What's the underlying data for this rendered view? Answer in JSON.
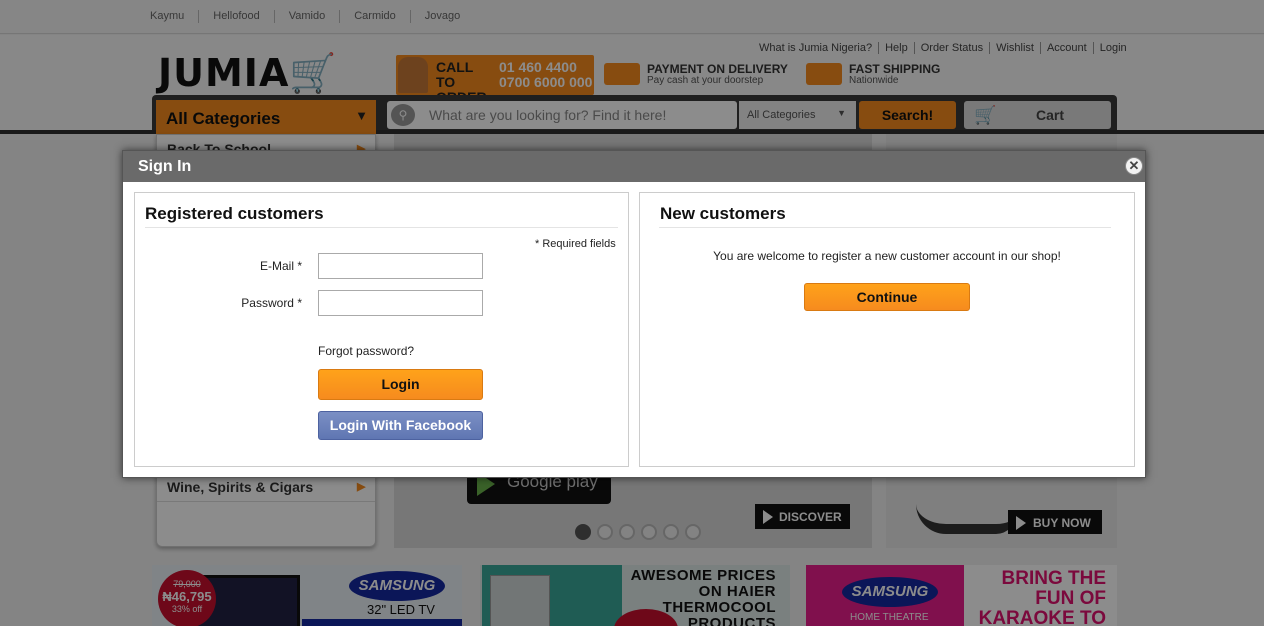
{
  "topbar": {
    "sites": [
      "Kaymu",
      "Hellofood",
      "Vamido",
      "Carmido",
      "Jovago"
    ]
  },
  "header": {
    "logo": "JUMIA",
    "links": [
      "What is Jumia Nigeria?",
      "Help",
      "Order Status",
      "Wishlist",
      "Account",
      "Login"
    ],
    "promo_call": {
      "title": "CALL TO ORDER",
      "numbers": "01 460 4400\n0700 6000 000"
    },
    "promo_pay": {
      "title": "PAYMENT ON DELIVERY",
      "sub": "Pay cash at your doorstep"
    },
    "promo_ship": {
      "title": "FAST SHIPPING",
      "sub": "Nationwide"
    }
  },
  "nav": {
    "all_categories": "All Categories",
    "search_placeholder": "What are you looking for? Find it here!",
    "search_category": "All Categories",
    "search_button": "Search!",
    "cart": "Cart"
  },
  "categories": {
    "first": "Back To School",
    "last": "Wine, Spirits & Cigars"
  },
  "slider": {
    "store_badge": "Google play",
    "discover": "DISCOVER",
    "dots": 6,
    "active_dot": 0
  },
  "side_ad": {
    "buy_now": "BUY NOW"
  },
  "ads": {
    "ad1": {
      "old_price": "79,000",
      "price": "₦46,795",
      "discount": "33% off",
      "brand": "SAMSUNG",
      "product": "32\" LED TV"
    },
    "ad2": {
      "text": "AWESOME PRICES ON HAIER THERMOCOOL PRODUCTS"
    },
    "ad3": {
      "brand": "SAMSUNG",
      "sub": "HOME THEATRE",
      "text": "BRING THE FUN OF KARAOKE TO YOUR HOME"
    }
  },
  "modal": {
    "title": "Sign In",
    "registered": {
      "heading": "Registered customers",
      "required_note": "* Required fields",
      "email_label": "E-Mail *",
      "email_value": "",
      "password_label": "Password *",
      "password_value": "",
      "forgot": "Forgot password?",
      "login": "Login",
      "login_facebook": "Login With Facebook"
    },
    "new_customers": {
      "heading": "New customers",
      "text": "You are welcome to register a new customer account in our shop!",
      "continue": "Continue"
    }
  },
  "colors": {
    "accent": "#f68b1e",
    "facebook": "#6a80bc",
    "overlay": "rgba(0,0,0,0.45)"
  }
}
